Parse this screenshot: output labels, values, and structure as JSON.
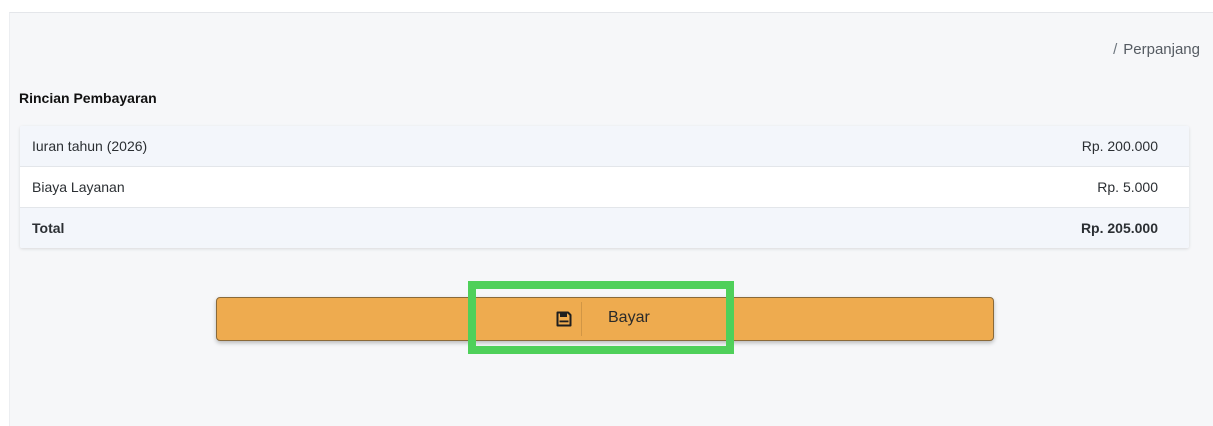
{
  "breadcrumb": {
    "separator": "/",
    "current": "Perpanjang"
  },
  "section_title": "Rincian Pembayaran",
  "payment_rows": [
    {
      "label": "Iuran tahun (2026)",
      "amount": "Rp. 200.000"
    },
    {
      "label": "Biaya Layanan",
      "amount": "Rp. 5.000"
    },
    {
      "label": "Total",
      "amount": "Rp. 205.000"
    }
  ],
  "pay_button": {
    "label": "Bayar",
    "icon": "save-icon"
  },
  "colors": {
    "button": "#eeab4f",
    "highlight": "#4fd05a",
    "panel": "#f6f7f9"
  }
}
